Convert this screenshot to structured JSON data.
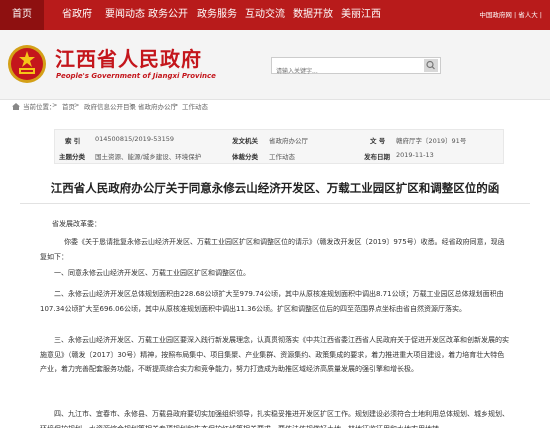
{
  "topnav": {
    "items": [
      "首页",
      "省政府",
      "要闻动态",
      "政务公开",
      "政务服务",
      "互动交流",
      "数据开放",
      "美丽江西"
    ],
    "right": "中国政府网 | 省人大 |"
  },
  "header": {
    "title": "江西省人民政府",
    "subtitle": "People's Government of Jiangxi Province",
    "search_placeholder": "请输入关键字..."
  },
  "breadcrumb": {
    "prefix": "当前位置：",
    "items": [
      "首页",
      "政府信息公开目录",
      "省政府办公厅",
      "工作动态"
    ],
    "sep": ">"
  },
  "info": {
    "index_label": "索  引",
    "index_value": "014500815/2019-53159",
    "issuer_label": "发文机关",
    "issuer_value": "省政府办公厅",
    "docno_label": "文  号",
    "docno_value": "赣府厅字〔2019〕91号",
    "topic_label": "主题分类",
    "topic_value": "国土资源、能源/城乡建设、环境保护",
    "category_label": "体裁分类",
    "category_value": "工作动态",
    "date_label": "发布日期",
    "date_value": "2019-11-13"
  },
  "article": {
    "title": "江西省人民政府办公厅关于同意永修云山经济开发区、万载工业园区扩区和调整区位的函",
    "salutation": "省发展改革委：",
    "paragraphs": [
      "你委《关于恳请批复永修云山经济开发区、万载工业园区扩区和调整区位的请示》（赣发改开发区〔2019〕975号）收悉。经省政府同意，现函复如下：",
      "一、同意永修云山经济开发区、万载工业园区扩区和调整区位。",
      "二、永修云山经济开发区总体规划面积由228.68公顷扩大至979.74公顷，其中从原核准规划面积中调出8.71公顷；万载工业园区总体规划面积由107.34公顷扩大至696.06公顷，其中从原核准规划面积中调出11.36公顷。扩区和调整区位后的四至范围界点坐标由省自然资源厅落实。",
      "三、永修云山经济开发区、万载工业园区要深入践行新发展理念，认真贯彻落实《中共江西省委江西省人民政府关于促进开发区改革和创新发展的实施意见》（赣发〔2017〕30号）精神，按照布局集中、项目集聚、产业集群、资源集约、政策集成的要求，着力推进重大项目建设，着力培育壮大特色产业，着力完善配套服务功能，不断提高综合实力和竞争能力，努力打造成为助推区域经济高质量发展的强引擎和增长极。",
      "四、九江市、宜春市、永修县、万载县政府要切实加强组织领导，扎实稳妥推进开发区扩区工作。规划建设必须符合土地利用总体规划、城乡规划、环境保护规划、水资源综合规划等相关专项规划和生态保护红线等相关要求。要依法依规做好土地、林地征收征用和水地农用地转"
    ]
  },
  "colors": {
    "nav_red": "#b81b1b",
    "title_red": "#c4161c"
  }
}
